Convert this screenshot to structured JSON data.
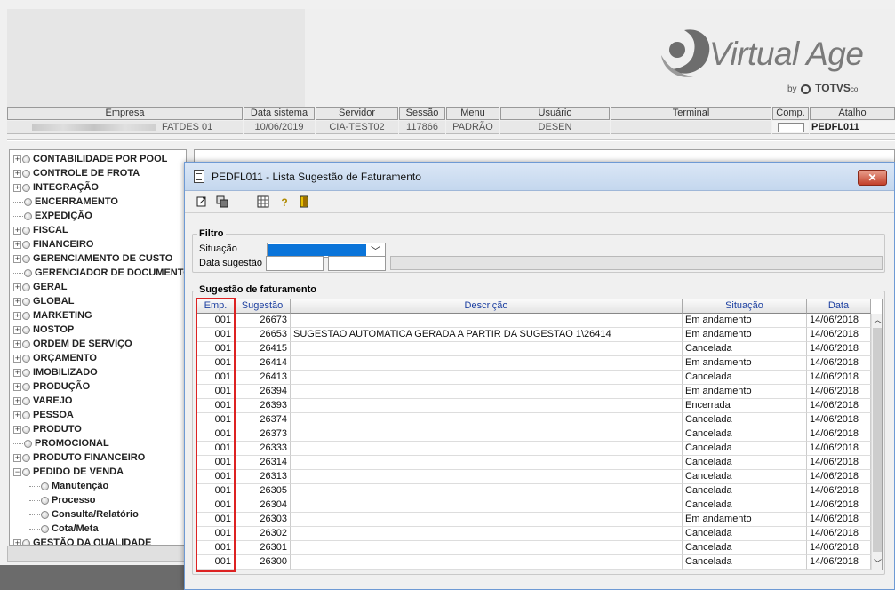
{
  "logo": {
    "text": "Virtual Age",
    "by": "by",
    "brand": "TOTVS",
    "brand_suffix": "co."
  },
  "info_bar": {
    "columns": [
      {
        "header": "Empresa",
        "value": "FATDES 01"
      },
      {
        "header": "Data sistema",
        "value": "10/06/2019"
      },
      {
        "header": "Servidor",
        "value": "CIA-TEST02"
      },
      {
        "header": "Sessão",
        "value": "117866"
      },
      {
        "header": "Menu",
        "value": "PADRÃO"
      },
      {
        "header": "Usuário",
        "value": "DESEN"
      },
      {
        "header": "Terminal",
        "value": ""
      },
      {
        "header": "Comp.",
        "value": ""
      },
      {
        "header": "Atalho",
        "value": "PEDFL011"
      }
    ]
  },
  "tree": {
    "items": [
      {
        "label": "CONTABILIDADE POR POOL",
        "expandable": true
      },
      {
        "label": "CONTROLE DE FROTA",
        "expandable": true
      },
      {
        "label": "INTEGRAÇÃO",
        "expandable": true
      },
      {
        "label": "ENCERRAMENTO",
        "expandable": false
      },
      {
        "label": "EXPEDIÇÃO",
        "expandable": false
      },
      {
        "label": "FISCAL",
        "expandable": true
      },
      {
        "label": "FINANCEIRO",
        "expandable": true
      },
      {
        "label": "GERENCIAMENTO DE CUSTO",
        "expandable": true
      },
      {
        "label": "GERENCIADOR DE DOCUMENTO",
        "expandable": false
      },
      {
        "label": "GERAL",
        "expandable": true
      },
      {
        "label": "GLOBAL",
        "expandable": true
      },
      {
        "label": "MARKETING",
        "expandable": true
      },
      {
        "label": "NOSTOP",
        "expandable": true
      },
      {
        "label": "ORDEM DE SERVIÇO",
        "expandable": true
      },
      {
        "label": "ORÇAMENTO",
        "expandable": true
      },
      {
        "label": "IMOBILIZADO",
        "expandable": true
      },
      {
        "label": "PRODUÇÃO",
        "expandable": true
      },
      {
        "label": "VAREJO",
        "expandable": true
      },
      {
        "label": "PESSOA",
        "expandable": true
      },
      {
        "label": "PRODUTO",
        "expandable": true
      },
      {
        "label": "PROMOCIONAL",
        "expandable": false
      },
      {
        "label": "PRODUTO FINANCEIRO",
        "expandable": true
      },
      {
        "label": "PEDIDO DE VENDA",
        "expandable": true,
        "expanded": true
      },
      {
        "label": "Manutenção",
        "child": true
      },
      {
        "label": "Processo",
        "child": true
      },
      {
        "label": "Consulta/Relatório",
        "child": true
      },
      {
        "label": "Cota/Meta",
        "child": true
      },
      {
        "label": "GESTÃO DA QUALIDADE",
        "expandable": true
      }
    ]
  },
  "window": {
    "title": "PEDFL011 - Lista Sugestão de Faturamento",
    "close_label": "✕"
  },
  "filter": {
    "title": "Filtro",
    "situacao_label": "Situação",
    "data_label": "Data sugestão"
  },
  "grid": {
    "title": "Sugestão de faturamento",
    "columns": [
      "Emp.",
      "Sugestão",
      "Descrição",
      "Situação",
      "Data"
    ],
    "rows": [
      [
        "001",
        "26673",
        "",
        "Em andamento",
        "14/06/2018"
      ],
      [
        "001",
        "26653",
        "SUGESTAO AUTOMATICA GERADA A PARTIR DA SUGESTAO 1\\26414",
        "Em andamento",
        "14/06/2018"
      ],
      [
        "001",
        "26415",
        "",
        "Cancelada",
        "14/06/2018"
      ],
      [
        "001",
        "26414",
        "",
        "Em andamento",
        "14/06/2018"
      ],
      [
        "001",
        "26413",
        "",
        "Cancelada",
        "14/06/2018"
      ],
      [
        "001",
        "26394",
        "",
        "Em andamento",
        "14/06/2018"
      ],
      [
        "001",
        "26393",
        "",
        "Encerrada",
        "14/06/2018"
      ],
      [
        "001",
        "26374",
        "",
        "Cancelada",
        "14/06/2018"
      ],
      [
        "001",
        "26373",
        "",
        "Cancelada",
        "14/06/2018"
      ],
      [
        "001",
        "26333",
        "",
        "Cancelada",
        "14/06/2018"
      ],
      [
        "001",
        "26314",
        "",
        "Cancelada",
        "14/06/2018"
      ],
      [
        "001",
        "26313",
        "",
        "Cancelada",
        "14/06/2018"
      ],
      [
        "001",
        "26305",
        "",
        "Cancelada",
        "14/06/2018"
      ],
      [
        "001",
        "26304",
        "",
        "Cancelada",
        "14/06/2018"
      ],
      [
        "001",
        "26303",
        "",
        "Em andamento",
        "14/06/2018"
      ],
      [
        "001",
        "26302",
        "",
        "Cancelada",
        "14/06/2018"
      ],
      [
        "001",
        "26301",
        "",
        "Cancelada",
        "14/06/2018"
      ],
      [
        "001",
        "26300",
        "",
        "Cancelada",
        "14/06/2018"
      ]
    ]
  },
  "colors": {
    "highlight": "#d22222",
    "selection": "#0a74d9",
    "close_button": "#c2402a"
  }
}
